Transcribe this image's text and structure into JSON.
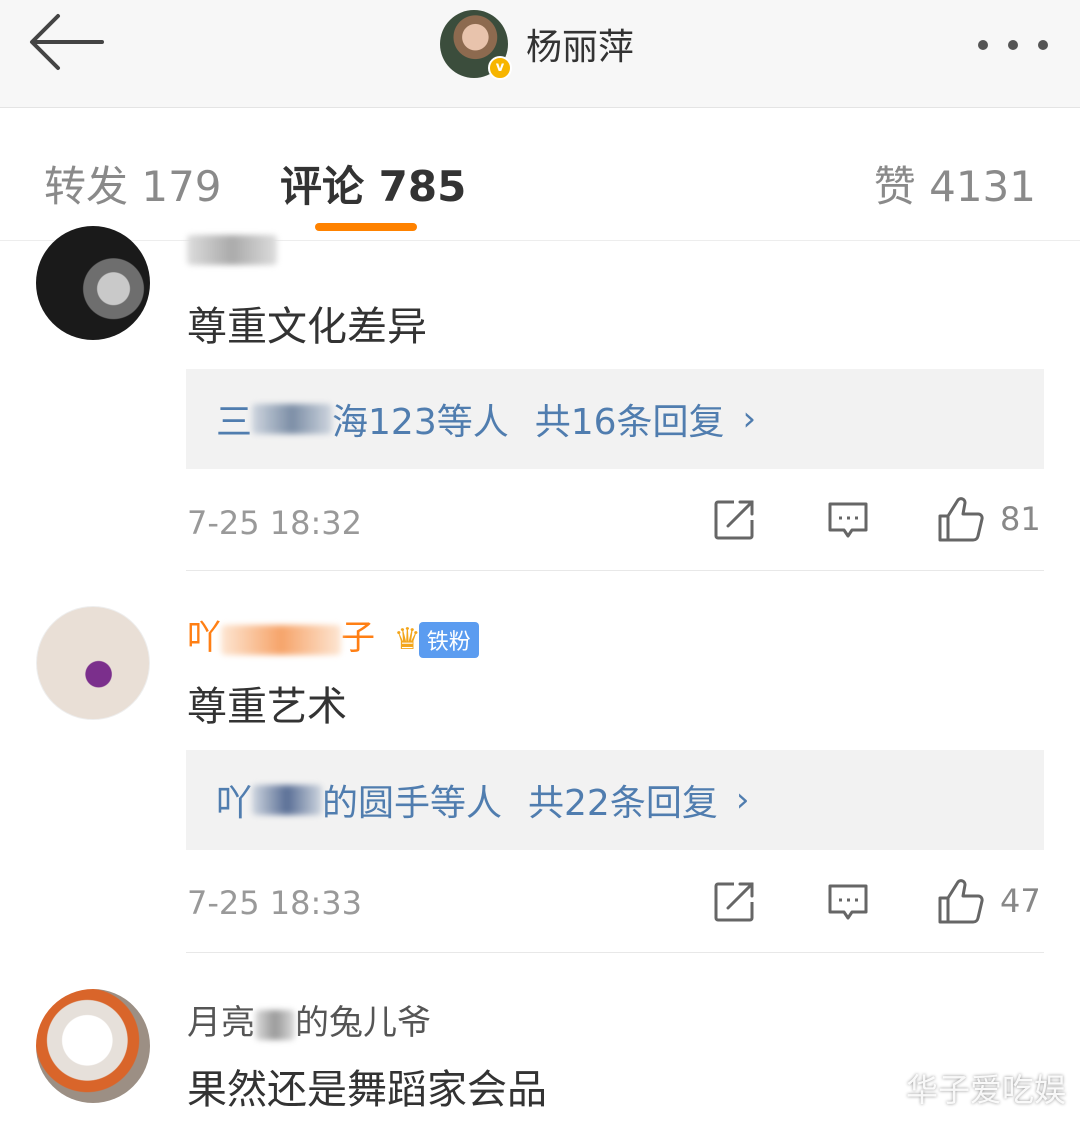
{
  "header": {
    "back_icon": "arrow-left-icon",
    "username": "杨丽萍",
    "verified_badge": "v",
    "more_icon": "more-dots-icon"
  },
  "tabs": [
    {
      "label": "转发 179",
      "active": false
    },
    {
      "label": "评论 785",
      "active": true
    },
    {
      "label": "赞 4131",
      "active": false
    }
  ],
  "accent_color": "#ff8200",
  "link_color": "#507daf",
  "comments": [
    {
      "username": "",
      "text": "尊重文化差异",
      "reply_users_start": "三",
      "reply_users_end": "海123等人",
      "reply_count": "共16条回复",
      "time": "7-25 18:32",
      "likes": "81"
    },
    {
      "username_start": "吖",
      "username_end": "子",
      "fan_badge": "铁粉",
      "text": "尊重艺术",
      "reply_users_start": "吖",
      "reply_users_end": "的圆手等人",
      "reply_count": "共22条回复",
      "time": "7-25 18:33",
      "likes": "47"
    },
    {
      "username_start": "月亮",
      "username_end": "的兔儿爷",
      "text": "果然还是舞蹈家会品"
    }
  ],
  "icons": {
    "share": "share-icon",
    "comment": "comment-icon",
    "like": "thumbs-up-icon",
    "chevron": "chevron-right-icon"
  },
  "chevron_glyph": "›",
  "watermark": "华子爱吃娱"
}
